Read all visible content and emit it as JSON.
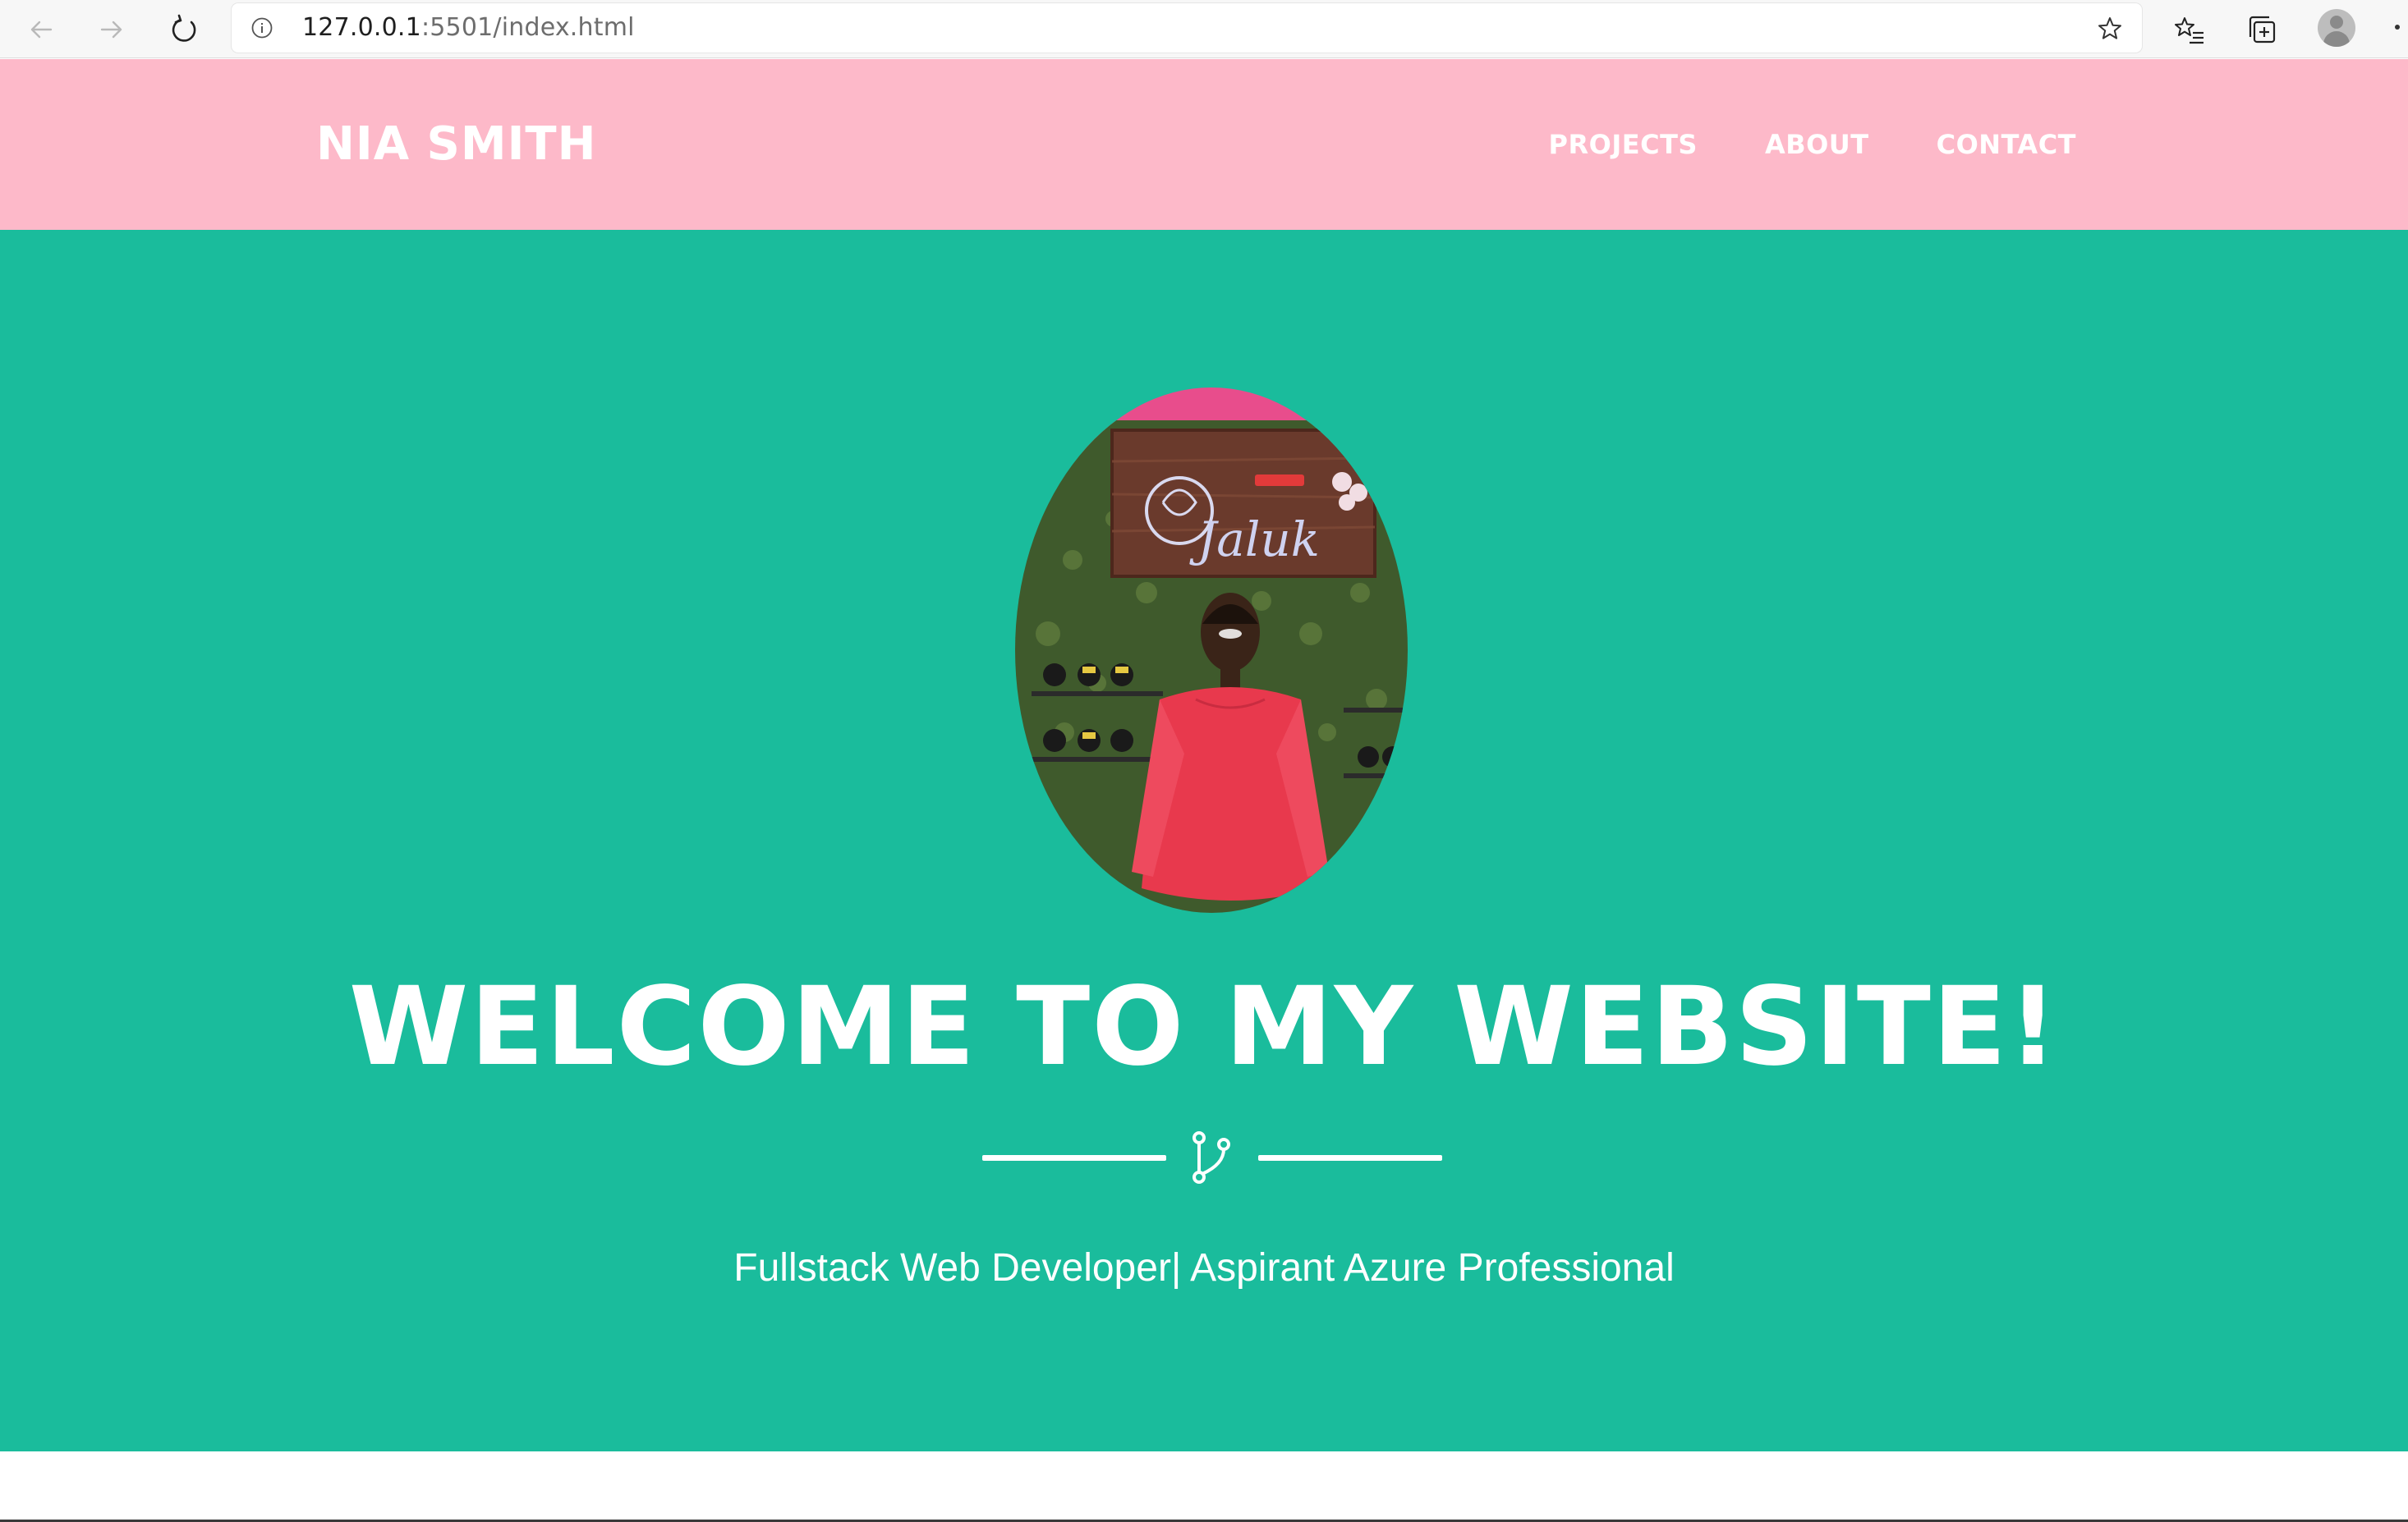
{
  "browser": {
    "url_host": "127.0.0.1",
    "url_rest": ":5501/index.html"
  },
  "site": {
    "brand": "NIA SMITH",
    "nav": [
      {
        "label": "PROJECTS"
      },
      {
        "label": "ABOUT"
      },
      {
        "label": "CONTACT"
      }
    ]
  },
  "hero": {
    "title": "WELCOME TO MY WEBSITE!",
    "subtitle": "Fullstack Web Developer| Aspirant Azure Professional",
    "sign_text": "Jaluk"
  },
  "colors": {
    "header_bg": "#fdb9c9",
    "hero_bg": "#1abc9c",
    "text": "#ffffff"
  }
}
